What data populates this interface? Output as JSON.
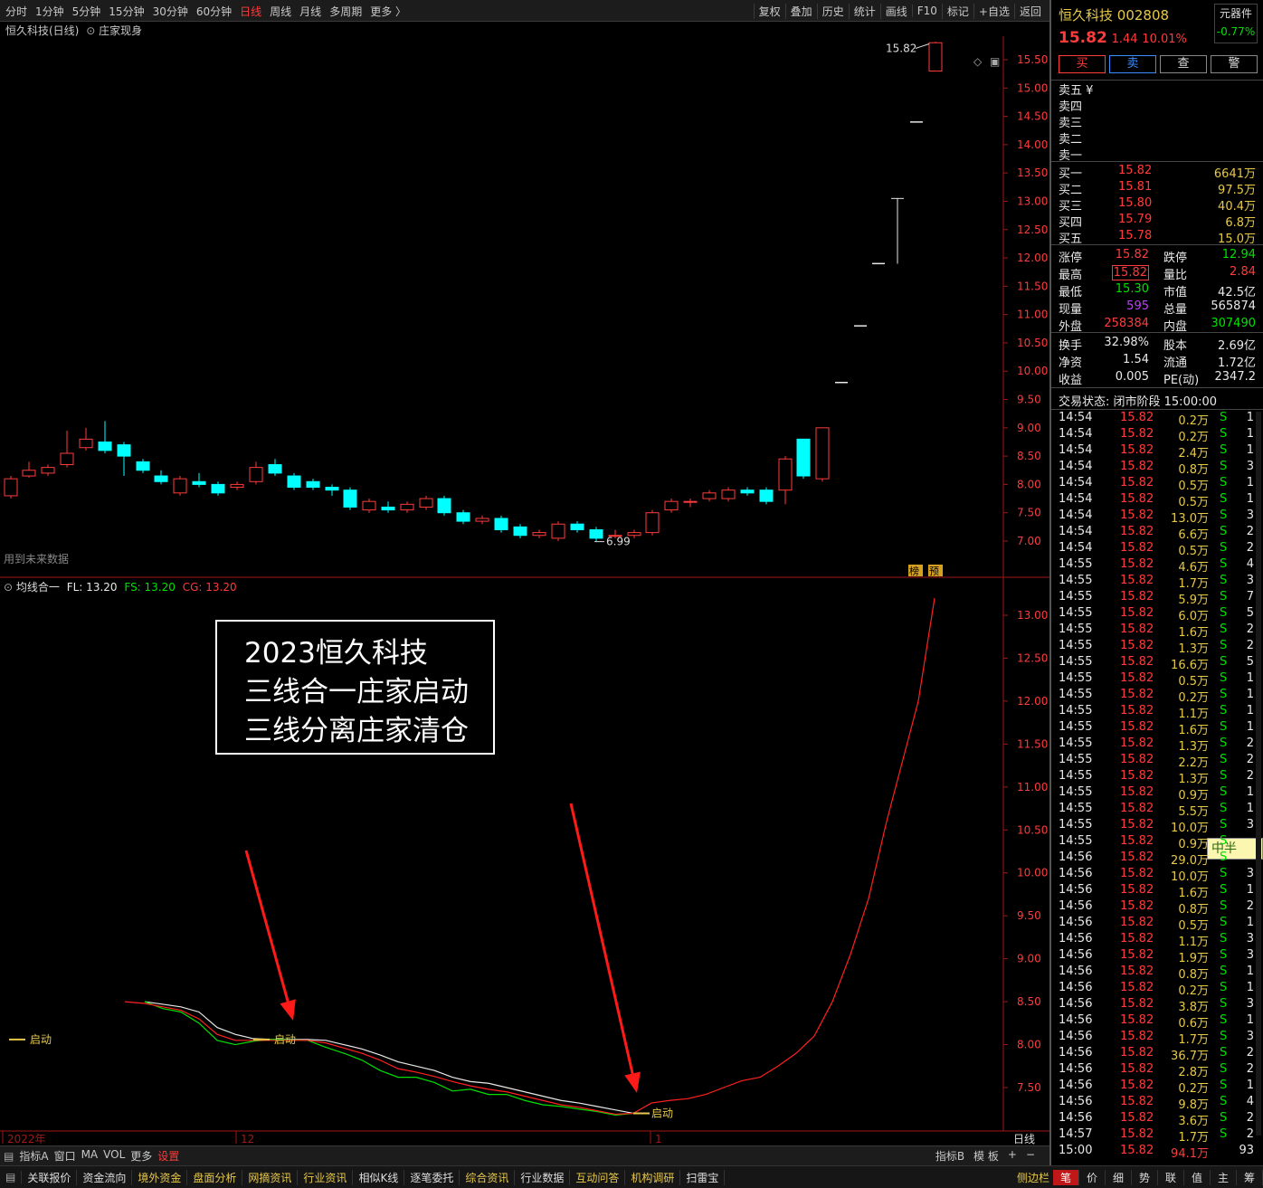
{
  "toolbar": {
    "periods": [
      "分时",
      "1分钟",
      "5分钟",
      "15分钟",
      "30分钟",
      "60分钟",
      "日线",
      "周线",
      "月线",
      "多周期",
      "更多 〉"
    ],
    "active_period": "日线",
    "tools": [
      "复权",
      "叠加",
      "历史",
      "统计",
      "画线",
      "F10",
      "标记",
      "+自选",
      "返回"
    ]
  },
  "chart": {
    "title": "恒久科技(日线)",
    "indicator": "庄家现身",
    "note": "用到未来数据",
    "high_label": "15.82",
    "low_label": "6.99",
    "badges": [
      "榜",
      "预"
    ],
    "price_ticks": [
      "15.50",
      "15.00",
      "14.50",
      "14.00",
      "13.50",
      "13.00",
      "12.50",
      "12.00",
      "11.50",
      "11.00",
      "10.50",
      "10.00",
      "9.50",
      "9.00",
      "8.50",
      "8.00",
      "7.50",
      "7.00"
    ],
    "sub_title": "均线合一",
    "fl": "FL: 13.20",
    "fs": "FS: 13.20",
    "cg": "CG: 13.20",
    "sub_ticks": [
      "13.00",
      "12.50",
      "12.00",
      "11.50",
      "11.00",
      "10.50",
      "10.00",
      "9.50",
      "9.00",
      "8.50",
      "8.00",
      "7.50"
    ],
    "start_label": "启动",
    "x_labels": [
      "2022年",
      "12",
      "1"
    ],
    "period_label": "日线"
  },
  "annotation": {
    "line1": "2023恒久科技",
    "line2": "三线合一庄家启动",
    "line3": "三线分离庄家清仓"
  },
  "bottom": {
    "row1": [
      "指标A",
      "窗口",
      "MA",
      "VOL",
      "更多",
      "设置"
    ],
    "row1_right": [
      "指标B",
      "模 板",
      "+",
      "−"
    ],
    "row2": [
      "关联报价",
      "资金流向",
      "境外资金",
      "盘面分析",
      "网摘资讯",
      "行业资讯",
      "相似K线",
      "逐笔委托",
      "综合资讯",
      "行业数据",
      "互动问答",
      "机构调研",
      "扫雷宝"
    ],
    "row2_right": "侧边栏",
    "row2_tabs": [
      "笔",
      "价",
      "细",
      "势",
      "联",
      "值",
      "主",
      "筹"
    ]
  },
  "stock": {
    "name": "恒久科技",
    "code": "002808",
    "badge": "元器件",
    "badge_change": "-0.77%",
    "price": "15.82",
    "change": "1.44",
    "pct": "10.01%",
    "buttons": [
      "买",
      "卖",
      "查",
      "警"
    ],
    "sells": [
      "卖五 ¥",
      "卖四",
      "卖三",
      "卖二",
      "卖一"
    ],
    "buys": [
      {
        "label": "买一",
        "price": "15.82",
        "vol": "6641万"
      },
      {
        "label": "买二",
        "price": "15.81",
        "vol": "97.5万"
      },
      {
        "label": "买三",
        "price": "15.80",
        "vol": "40.4万"
      },
      {
        "label": "买四",
        "price": "15.79",
        "vol": "6.8万"
      },
      {
        "label": "买五",
        "price": "15.78",
        "vol": "15.0万"
      }
    ],
    "stats": [
      {
        "l1": "涨停",
        "v1": "15.82",
        "l2": "跌停",
        "v2": "12.94"
      },
      {
        "l1": "最高",
        "v1": "15.82",
        "l2": "量比",
        "v2": "2.84"
      },
      {
        "l1": "最低",
        "v1": "15.30",
        "l2": "市值",
        "v2": "42.5亿"
      },
      {
        "l1": "现量",
        "v1": "595",
        "l2": "总量",
        "v2": "565874"
      },
      {
        "l1": "外盘",
        "v1": "258384",
        "l2": "内盘",
        "v2": "307490"
      }
    ],
    "stats2": [
      {
        "l1": "换手",
        "v1": "32.98%",
        "l2": "股本",
        "v2": "2.69亿"
      },
      {
        "l1": "净资",
        "v1": "1.54",
        "l2": "流通",
        "v2": "1.72亿"
      },
      {
        "l1": "收益",
        "v1": "0.005",
        "l2": "PE(动)",
        "v2": "2347.2"
      }
    ],
    "status": "交易状态: 闭市阶段 15:00:00",
    "tooltip": "中半",
    "ticks": [
      {
        "t": "14:54",
        "p": "15.82",
        "v": "0.2万",
        "n": "1"
      },
      {
        "t": "14:54",
        "p": "15.82",
        "v": "0.2万",
        "n": "1"
      },
      {
        "t": "14:54",
        "p": "15.82",
        "v": "2.4万",
        "n": "1"
      },
      {
        "t": "14:54",
        "p": "15.82",
        "v": "0.8万",
        "n": "3"
      },
      {
        "t": "14:54",
        "p": "15.82",
        "v": "0.5万",
        "n": "1"
      },
      {
        "t": "14:54",
        "p": "15.82",
        "v": "0.5万",
        "n": "1"
      },
      {
        "t": "14:54",
        "p": "15.82",
        "v": "13.0万",
        "n": "3"
      },
      {
        "t": "14:54",
        "p": "15.82",
        "v": "6.6万",
        "n": "2"
      },
      {
        "t": "14:54",
        "p": "15.82",
        "v": "0.5万",
        "n": "2"
      },
      {
        "t": "14:55",
        "p": "15.82",
        "v": "4.6万",
        "n": "4"
      },
      {
        "t": "14:55",
        "p": "15.82",
        "v": "1.7万",
        "n": "3"
      },
      {
        "t": "14:55",
        "p": "15.82",
        "v": "5.9万",
        "n": "7"
      },
      {
        "t": "14:55",
        "p": "15.82",
        "v": "6.0万",
        "n": "5"
      },
      {
        "t": "14:55",
        "p": "15.82",
        "v": "1.6万",
        "n": "2"
      },
      {
        "t": "14:55",
        "p": "15.82",
        "v": "1.3万",
        "n": "2"
      },
      {
        "t": "14:55",
        "p": "15.82",
        "v": "16.6万",
        "n": "5"
      },
      {
        "t": "14:55",
        "p": "15.82",
        "v": "0.5万",
        "n": "1"
      },
      {
        "t": "14:55",
        "p": "15.82",
        "v": "0.2万",
        "n": "1"
      },
      {
        "t": "14:55",
        "p": "15.82",
        "v": "1.1万",
        "n": "1"
      },
      {
        "t": "14:55",
        "p": "15.82",
        "v": "1.6万",
        "n": "1"
      },
      {
        "t": "14:55",
        "p": "15.82",
        "v": "1.3万",
        "n": "2"
      },
      {
        "t": "14:55",
        "p": "15.82",
        "v": "2.2万",
        "n": "2"
      },
      {
        "t": "14:55",
        "p": "15.82",
        "v": "1.3万",
        "n": "2"
      },
      {
        "t": "14:55",
        "p": "15.82",
        "v": "0.9万",
        "n": "1"
      },
      {
        "t": "14:55",
        "p": "15.82",
        "v": "5.5万",
        "n": "1"
      },
      {
        "t": "14:55",
        "p": "15.82",
        "v": "10.0万",
        "n": "3"
      },
      {
        "t": "14:55",
        "p": "15.82",
        "v": "0.9万",
        "n": ""
      },
      {
        "t": "14:56",
        "p": "15.82",
        "v": "29.0万",
        "n": ""
      },
      {
        "t": "14:56",
        "p": "15.82",
        "v": "10.0万",
        "n": "3"
      },
      {
        "t": "14:56",
        "p": "15.82",
        "v": "1.6万",
        "n": "1"
      },
      {
        "t": "14:56",
        "p": "15.82",
        "v": "0.8万",
        "n": "2"
      },
      {
        "t": "14:56",
        "p": "15.82",
        "v": "0.5万",
        "n": "1"
      },
      {
        "t": "14:56",
        "p": "15.82",
        "v": "1.1万",
        "n": "3"
      },
      {
        "t": "14:56",
        "p": "15.82",
        "v": "1.9万",
        "n": "3"
      },
      {
        "t": "14:56",
        "p": "15.82",
        "v": "0.8万",
        "n": "1"
      },
      {
        "t": "14:56",
        "p": "15.82",
        "v": "0.2万",
        "n": "1"
      },
      {
        "t": "14:56",
        "p": "15.82",
        "v": "3.8万",
        "n": "3"
      },
      {
        "t": "14:56",
        "p": "15.82",
        "v": "0.6万",
        "n": "1"
      },
      {
        "t": "14:56",
        "p": "15.82",
        "v": "1.7万",
        "n": "3"
      },
      {
        "t": "14:56",
        "p": "15.82",
        "v": "36.7万",
        "n": "2"
      },
      {
        "t": "14:56",
        "p": "15.82",
        "v": "2.8万",
        "n": "2"
      },
      {
        "t": "14:56",
        "p": "15.82",
        "v": "0.2万",
        "n": "1"
      },
      {
        "t": "14:56",
        "p": "15.82",
        "v": "9.8万",
        "n": "4"
      },
      {
        "t": "14:56",
        "p": "15.82",
        "v": "3.6万",
        "n": "2"
      },
      {
        "t": "14:57",
        "p": "15.82",
        "v": "1.7万",
        "n": "2"
      },
      {
        "t": "15:00",
        "p": "15.82",
        "v": "94.1万",
        "n": "93"
      }
    ]
  }
}
